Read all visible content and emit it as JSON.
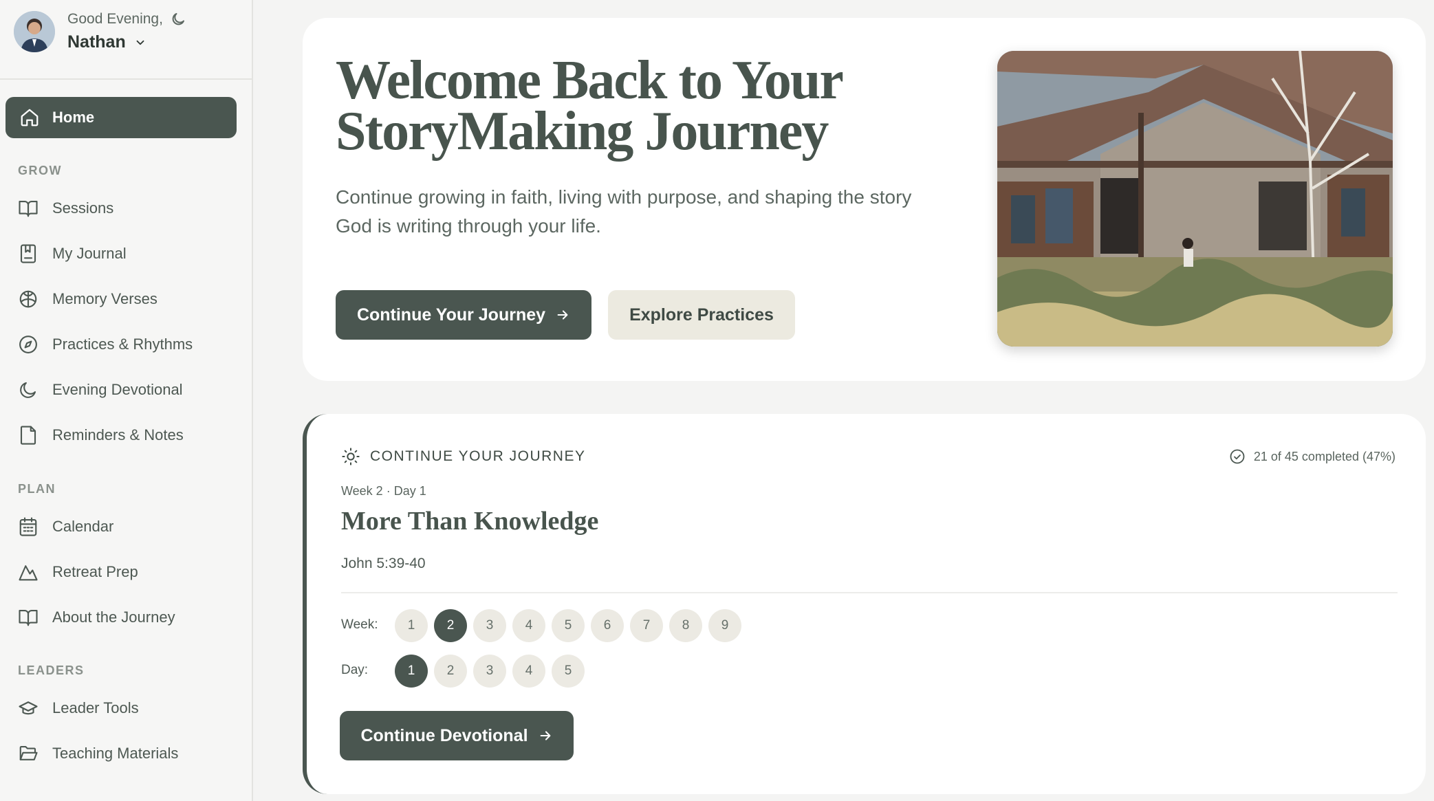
{
  "profile": {
    "greeting": "Good Evening,",
    "name": "Nathan"
  },
  "nav": {
    "home": "Home",
    "sections": [
      {
        "label": "GROW",
        "items": [
          "Sessions",
          "My Journal",
          "Memory Verses",
          "Practices & Rhythms",
          "Evening Devotional",
          "Reminders & Notes"
        ]
      },
      {
        "label": "PLAN",
        "items": [
          "Calendar",
          "Retreat Prep",
          "About the Journey"
        ]
      },
      {
        "label": "LEADERS",
        "items": [
          "Leader Tools",
          "Teaching Materials"
        ]
      }
    ]
  },
  "hero": {
    "title": "Welcome Back to Your StoryMaking Journey",
    "subtitle": "Continue growing in faith, living with purpose, and shaping the story God is writing through your life.",
    "primary_button": "Continue Your Journey",
    "secondary_button": "Explore Practices"
  },
  "journey": {
    "header": "CONTINUE YOUR JOURNEY",
    "progress": "21 of 45 completed (47%)",
    "meta": "Week 2 · Day 1",
    "title": "More Than Knowledge",
    "verse": "John 5:39-40",
    "week_label": "Week:",
    "weeks": [
      "1",
      "2",
      "3",
      "4",
      "5",
      "6",
      "7",
      "8",
      "9"
    ],
    "active_week": 2,
    "day_label": "Day:",
    "days": [
      "1",
      "2",
      "3",
      "4",
      "5"
    ],
    "active_day": 1,
    "button": "Continue Devotional"
  },
  "colors": {
    "accent": "#4a5650",
    "secondary_button": "#eceae0",
    "pill": "#eceae3",
    "background": "#f4f4f3"
  }
}
